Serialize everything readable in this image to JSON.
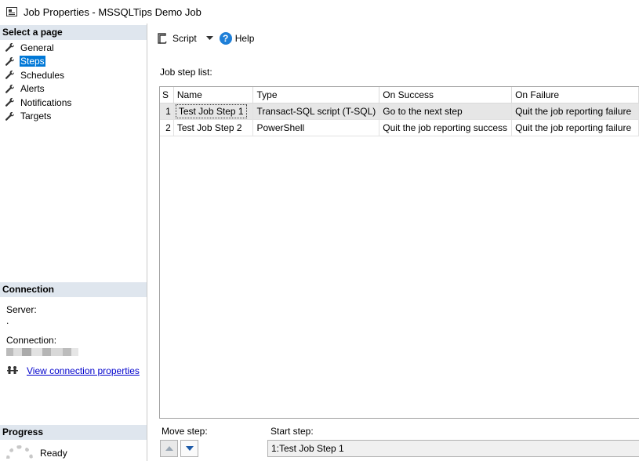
{
  "window": {
    "title": "Job Properties - MSSQLTips Demo Job"
  },
  "left": {
    "select_page_header": "Select a page",
    "pages": [
      {
        "label": "General",
        "icon": "wrench-icon"
      },
      {
        "label": "Steps",
        "icon": "wrench-icon",
        "selected": true
      },
      {
        "label": "Schedules",
        "icon": "wrench-icon"
      },
      {
        "label": "Alerts",
        "icon": "wrench-icon"
      },
      {
        "label": "Notifications",
        "icon": "wrench-icon"
      },
      {
        "label": "Targets",
        "icon": "wrench-icon"
      }
    ],
    "connection_header": "Connection",
    "server_label": "Server:",
    "server_value": ".",
    "connection_label": "Connection:",
    "view_connection_link": "View connection properties",
    "progress_header": "Progress",
    "progress_status": "Ready"
  },
  "toolbar": {
    "script_label": "Script",
    "help_label": "Help"
  },
  "steps": {
    "list_label": "Job step list:",
    "columns": [
      "S",
      "Name",
      "Type",
      "On Success",
      "On Failure"
    ],
    "rows": [
      {
        "step": "1",
        "name": "Test Job Step 1",
        "type": "Transact-SQL script (T-SQL)",
        "on_success": "Go to the next step",
        "on_failure": "Quit the job reporting failure",
        "selected": true
      },
      {
        "step": "2",
        "name": "Test Job Step 2",
        "type": "PowerShell",
        "on_success": "Quit the job reporting success",
        "on_failure": "Quit the job reporting failure"
      }
    ],
    "move_step_label": "Move step:",
    "start_step_label": "Start step:",
    "start_step_value": "1:Test Job Step 1"
  },
  "colors": {
    "section_header_bg": "#dfe6ee",
    "selection_blue": "#0078d7",
    "link_blue": "#0000cc",
    "help_blue": "#1e7fd8"
  }
}
